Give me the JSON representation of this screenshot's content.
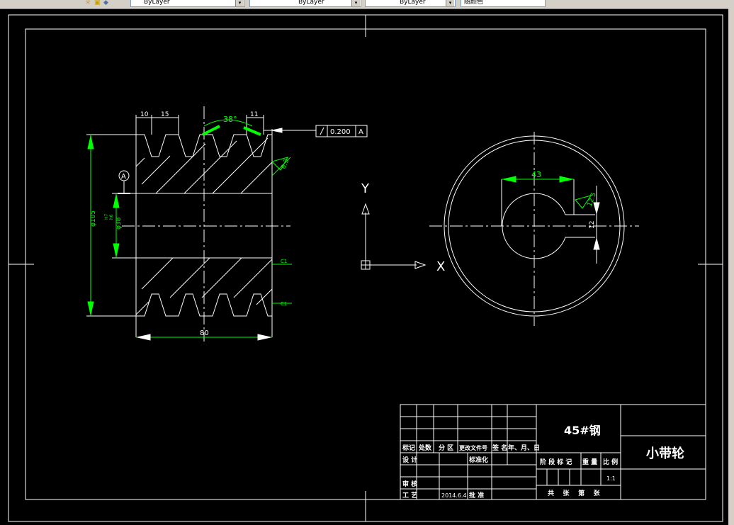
{
  "toolbar": {
    "layer1": "ByLayer",
    "layer2": "ByLayer",
    "layer3": "ByLayer",
    "color_combo": "随颜色"
  },
  "drawing": {
    "dim_10": "10",
    "dim_15": "15",
    "dim_38deg": "38°",
    "dim_11": "11",
    "runout_value": "0.200",
    "datum_letter": "A",
    "datum_marker": "A",
    "rough_63": "6.3",
    "dim_105": "φ105",
    "dim_38h7": "φ38",
    "dim_38_tol_upper": "H7",
    "dim_38_tol_lower": "h6",
    "chamfer_1": "C1",
    "chamfer_2": "C1",
    "dim_80": "80",
    "axis_y": "Y",
    "axis_x": "X",
    "dim_43": "43",
    "rough_125": "12.5",
    "dim_12": "12"
  },
  "title_block": {
    "material": "45#钢",
    "part_name": "小带轮",
    "col_mark": "标记",
    "col_count": "处数",
    "col_zone": "分 区",
    "col_change_doc": "更改文件号",
    "col_sign": "签 名",
    "col_date": "年、月、日",
    "row_design": "设 计",
    "row_standard": "标准化",
    "row_review": "审 核",
    "row_process": "工 艺",
    "date_value": "2014.6.4",
    "approve": "批 准",
    "stage_mark": "阶 段 标 记",
    "weight": "重 量",
    "scale": "比 例",
    "scale_value": "1:1",
    "sheets": "共    张    第    张"
  }
}
